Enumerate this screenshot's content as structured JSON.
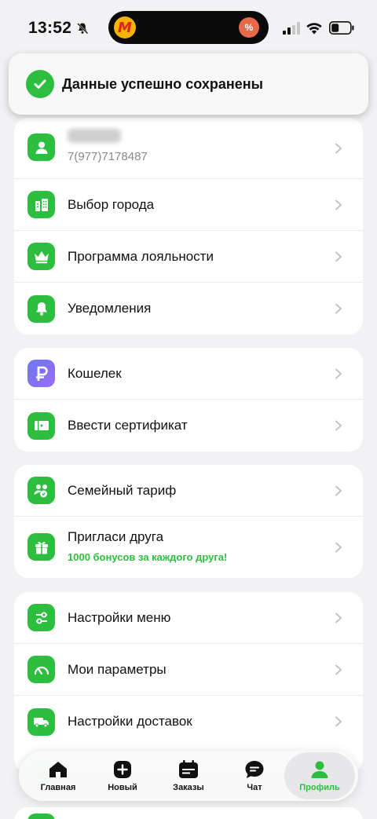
{
  "status_bar": {
    "time": "13:52"
  },
  "toast": {
    "message": "Данные успешно сохранены"
  },
  "profile": {
    "phone": "7(977)7178487"
  },
  "menu": {
    "city": "Выбор города",
    "loyalty": "Программа лояльности",
    "notifications": "Уведомления",
    "wallet": "Кошелек",
    "certificate": "Ввести сертификат",
    "family": "Семейный тариф",
    "invite": "Пригласи друга",
    "invite_sub": "1000 бонусов за каждого друга!",
    "menu_settings": "Настройки меню",
    "my_params": "Мои параметры",
    "delivery_settings": "Настройки доставок"
  },
  "tabbar": {
    "home": "Главная",
    "new": "Новый",
    "orders": "Заказы",
    "chat": "Чат",
    "profile": "Профиль"
  },
  "colors": {
    "accent": "#2dbe3f",
    "wallet_icon": "#7b72f3"
  }
}
